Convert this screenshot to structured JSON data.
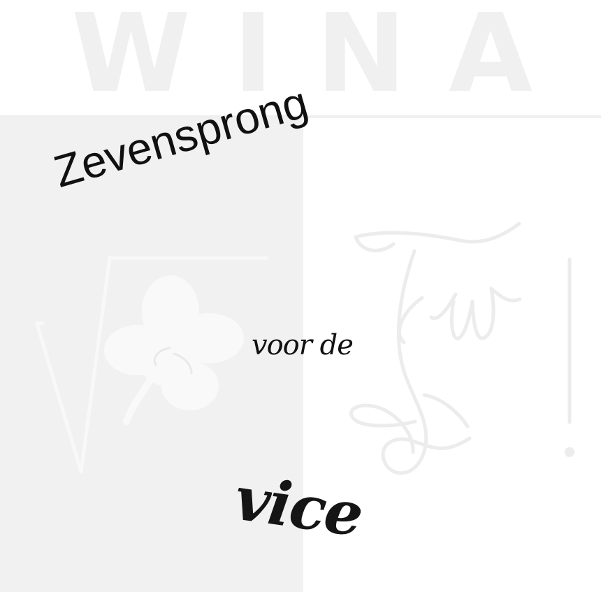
{
  "background": {
    "top_color": "#ffffff",
    "left_panel_color": "#f1f1f1",
    "right_panel_color": "#ffffff",
    "watermark_color": "#efefef",
    "text_color": "#111111"
  },
  "watermark": {
    "letters": [
      "W",
      "I",
      "N",
      "A"
    ],
    "root_symbol": "square-root-icon",
    "clover_symbol": "clover-icon",
    "monogram": "fw-monogram-logo"
  },
  "title": {
    "line1": "Zevensprong",
    "line2": "voor de",
    "line3": "vice"
  }
}
